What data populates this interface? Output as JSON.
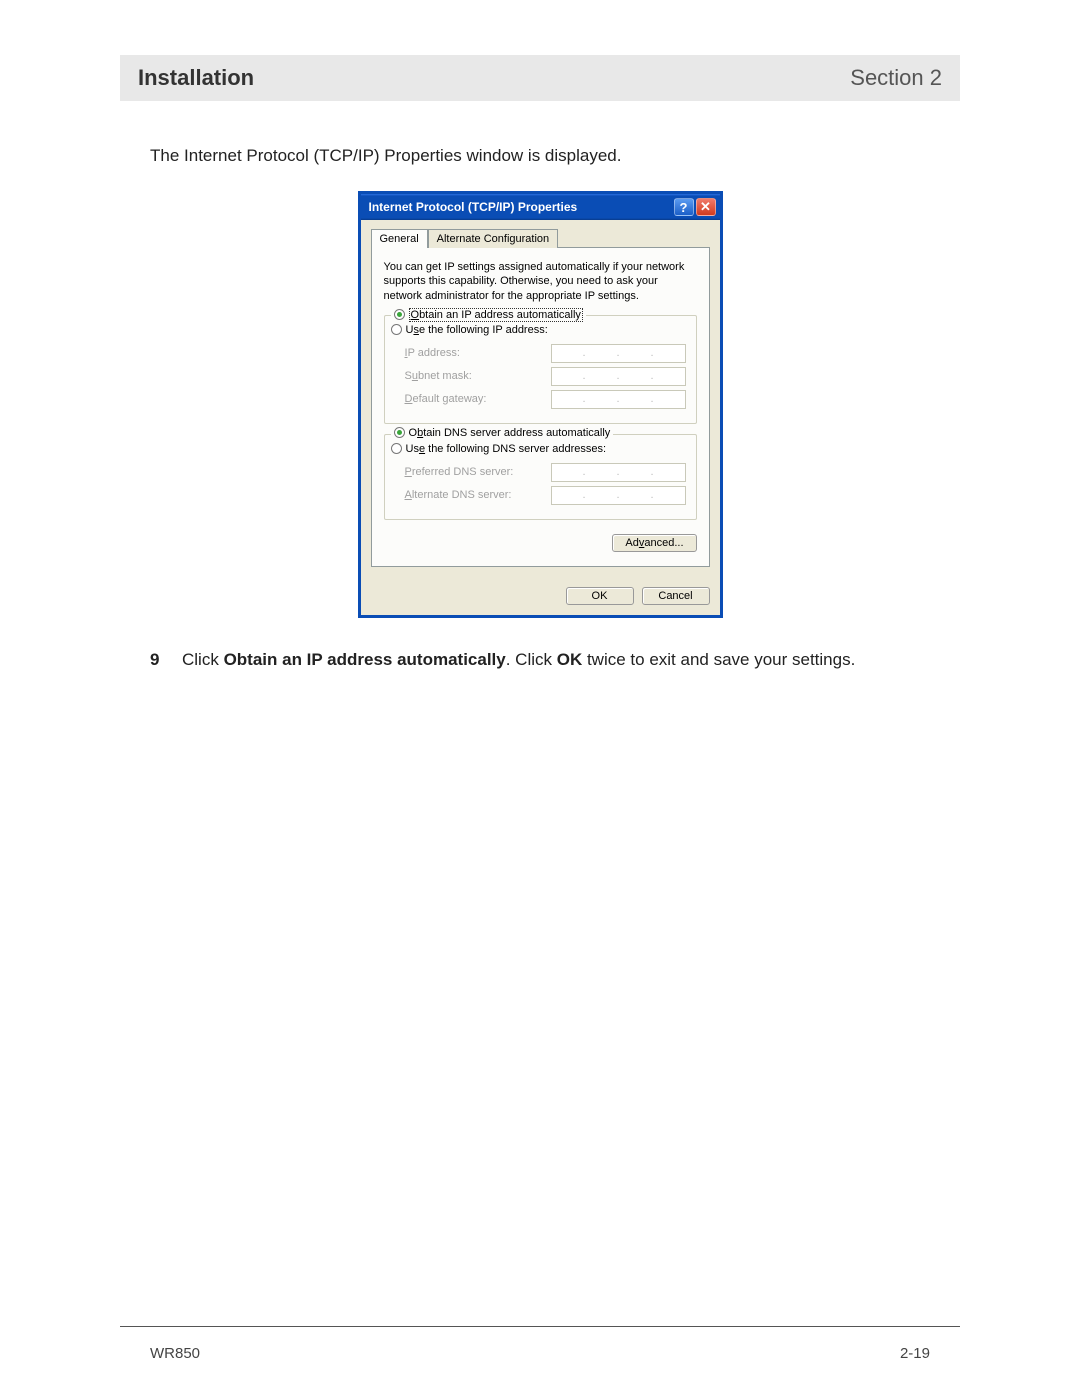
{
  "header": {
    "title": "Installation",
    "section": "Section 2"
  },
  "intro": "The Internet Protocol (TCP/IP) Properties window is displayed.",
  "dialog": {
    "title": "Internet Protocol (TCP/IP) Properties",
    "help": "?",
    "close": "✕",
    "tabs": {
      "general": "General",
      "alt": "Alternate Configuration"
    },
    "desc": "You can get IP settings assigned automatically if your network supports this capability. Otherwise, you need to ask your network administrator for the appropriate IP settings.",
    "ip": {
      "auto": "Obtain an IP address automatically",
      "manual": "Use the following IP address:",
      "ip_label": "IP address:",
      "subnet_label": "Subnet mask:",
      "gateway_label": "Default gateway:"
    },
    "dns": {
      "auto": "Obtain DNS server address automatically",
      "manual": "Use the following DNS server addresses:",
      "pref_label": "Preferred DNS server:",
      "alt_label": "Alternate DNS server:"
    },
    "advanced": "Advanced...",
    "ok": "OK",
    "cancel": "Cancel"
  },
  "step": {
    "num": "9",
    "pre": "Click ",
    "b1": "Obtain an IP address automatically",
    "mid": ". Click ",
    "b2": "OK",
    "post": " twice to exit and save your settings."
  },
  "footer": {
    "model": "WR850",
    "page": "2-19"
  }
}
